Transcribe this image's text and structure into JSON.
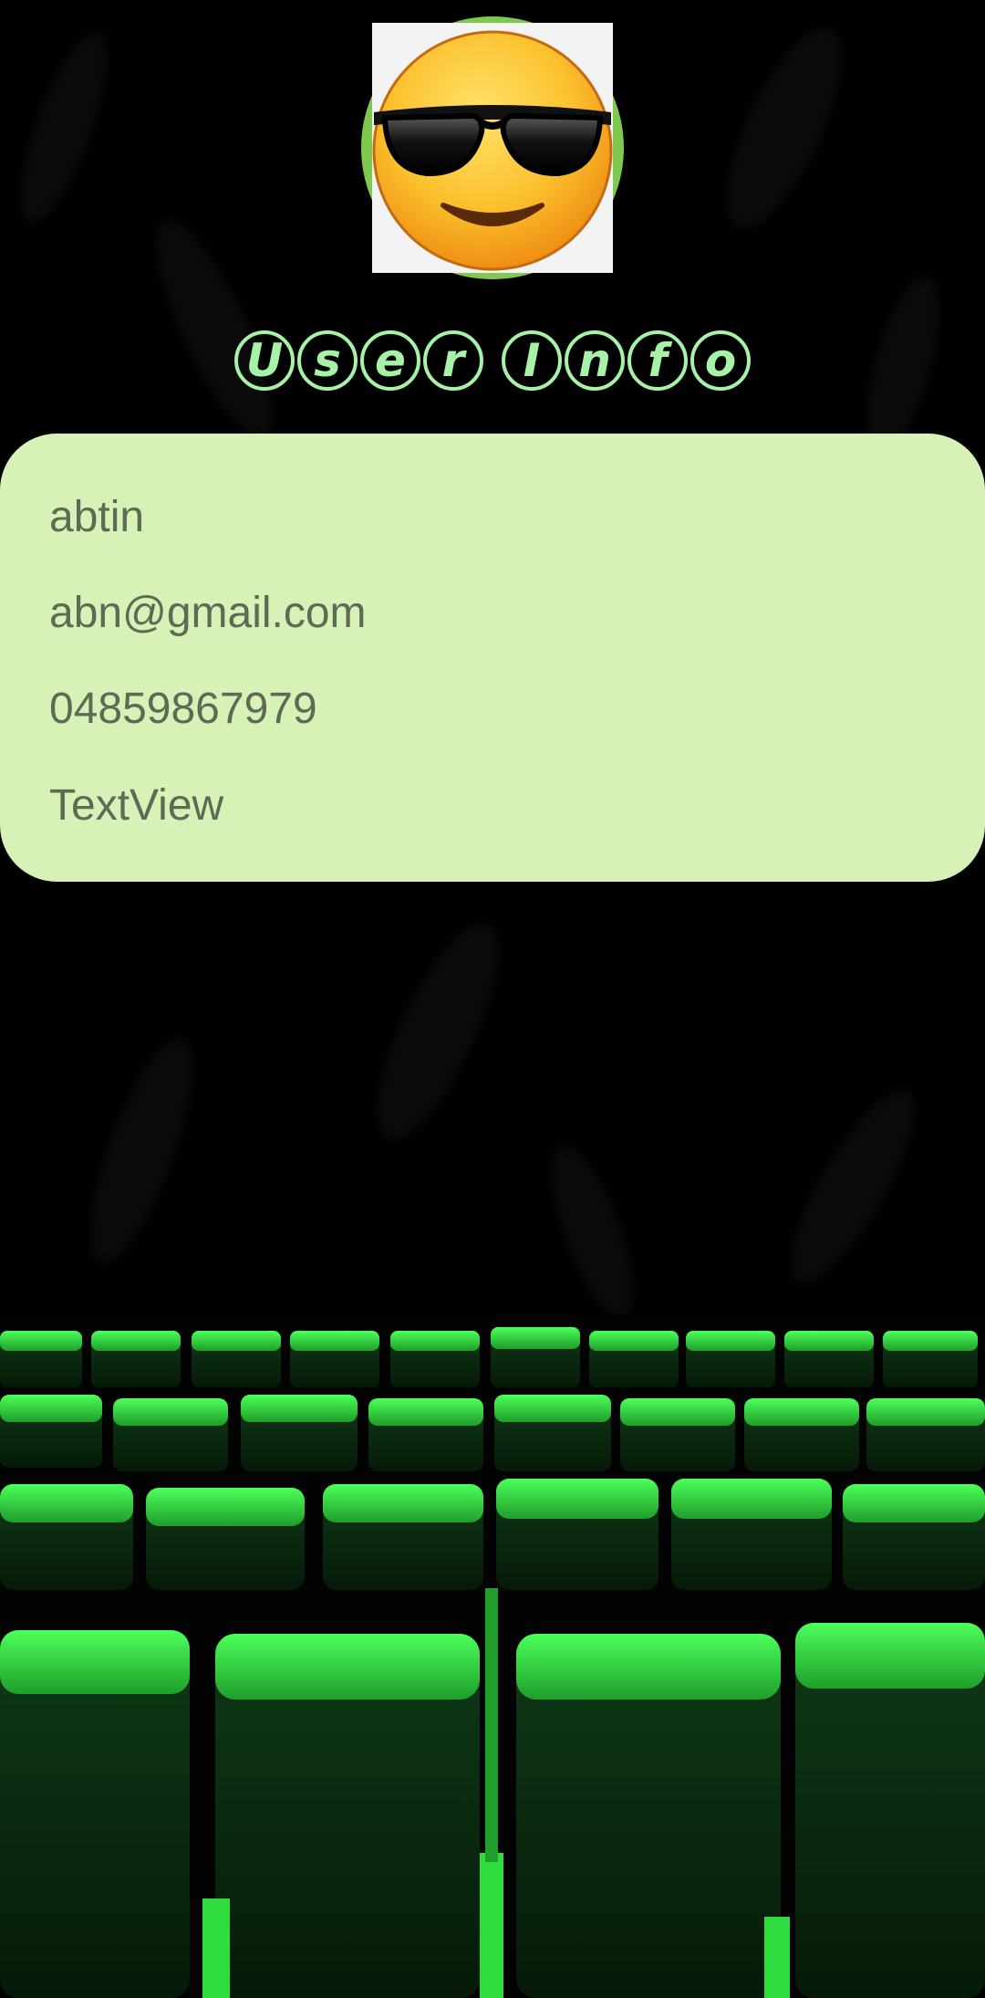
{
  "header": {
    "avatar_icon": "sunglasses-smiley-icon",
    "title_chars": [
      "U",
      "s",
      "e",
      "r",
      " ",
      "I",
      "n",
      "f",
      "o"
    ]
  },
  "user": {
    "name": "abtin",
    "email": "abn@gmail.com",
    "phone": "04859867979",
    "extra": "TextView"
  },
  "colors": {
    "background": "#000000",
    "card": "#d7f2b6",
    "card_text": "#5d6b55",
    "title_accent": "#a6f2a6",
    "avatar_ring": "#7fc94f",
    "seat_green": "#2fdc3e"
  },
  "background_icon": "theater-seats-illustration"
}
